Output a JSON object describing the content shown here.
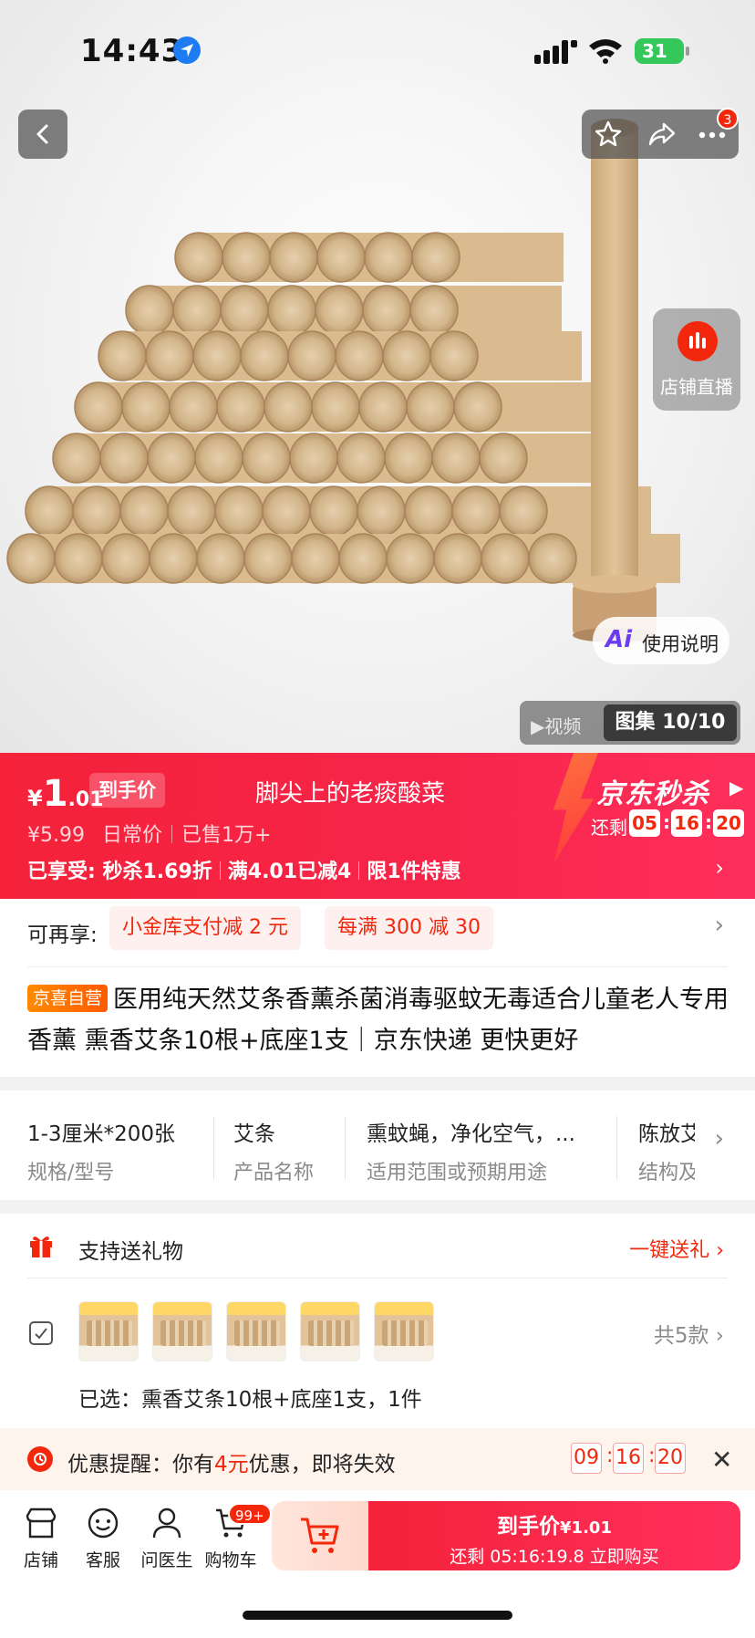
{
  "status_bar": {
    "time": "14:43",
    "battery": "31"
  },
  "colors": {
    "jd_red": "#f2270c",
    "banner_red": "#f5223a",
    "self_run_orange": "#ff7a00"
  },
  "icons": [
    "back-icon",
    "star-icon",
    "share-icon",
    "more-icon",
    "live-icon",
    "ai-icon",
    "play-icon",
    "gift-icon",
    "variant-icon",
    "alarm-icon",
    "close-icon",
    "shop-icon",
    "service-icon",
    "doctor-icon",
    "cart-icon",
    "add-cart-icon"
  ],
  "header": {
    "notification_badge": "3"
  },
  "hero": {
    "live_label": "店铺直播",
    "ai_label": "使用说明",
    "video_tab": "视频",
    "gallery_tab": "图集 10/10"
  },
  "price_banner": {
    "currency": "¥",
    "price_int": "1",
    "price_dec": ".01",
    "price_tag": "到手价",
    "note": "脚尖上的老痰酸菜",
    "original_price": "¥5.99",
    "original_label": "日常价",
    "sold": "已售1万+",
    "enjoyed_label": "已享受:",
    "benefit_1": "秒杀1.69折",
    "benefit_2": "满4.01已减4",
    "benefit_3": "限1件特惠",
    "flash_sale_title": "京东秒杀",
    "countdown_label": "还剩",
    "countdown_h": "05",
    "countdown_m": "16",
    "countdown_s": "20"
  },
  "info": {
    "coupon_label": "可再享:",
    "coupon_1": "小金库支付减 2 元",
    "coupon_2": "每满 300 减 30",
    "self_run_tag": "京喜自营",
    "title": "医用纯天然艾条香薰杀菌消毒驱蚊无毒适合儿童老人专用香薰 熏香艾条10根+底座1支｜京东快递 更快更好"
  },
  "specs": [
    {
      "value": "1-3厘米*200张",
      "key": "规格/型号"
    },
    {
      "value": "艾条",
      "key": "产品名称"
    },
    {
      "value": "熏蚊蝇，净化空气，...",
      "key": "适用范围或预期用途"
    },
    {
      "value": "陈放艾",
      "key": "结构及"
    }
  ],
  "gift": {
    "label": "支持送礼物",
    "link": "一键送礼"
  },
  "variants": {
    "count": "共5款",
    "selected": "已选：熏香艾条10根+底座1支，1件"
  },
  "promo": {
    "prefix": "优惠提醒：你有",
    "amount": "4元",
    "suffix": "优惠，即将失效",
    "h": "09",
    "m": "16",
    "s": "20"
  },
  "bottom_nav": {
    "shop": "店铺",
    "service": "客服",
    "doctor": "问医生",
    "cart": "购物车",
    "cart_badge": "99+",
    "buy_label": "到手价",
    "buy_price": "¥1.01",
    "buy_sub": "还剩 05:16:19.8 立即购买"
  }
}
